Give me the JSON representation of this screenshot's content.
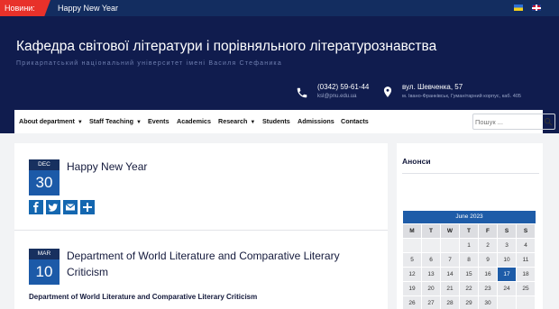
{
  "ticker": {
    "label": "Новини:",
    "headline": "Happy New Year"
  },
  "header": {
    "title": "Кафедра світової літератури і порівняльного літературознавства",
    "subtitle": "Прикарпатський національний університет імені Василя Стефаника",
    "phone": "(0342) 59-61-44",
    "email": "ksl@pnu.edu.ua",
    "street": "вул. Шевченка, 57",
    "address": "м. Івано-Франківськ, Гуманітарний корпус, каб. 405"
  },
  "nav": {
    "items": [
      {
        "label": "About department",
        "dropdown": true
      },
      {
        "label": "Staff Teaching",
        "dropdown": true
      },
      {
        "label": "Events",
        "dropdown": false
      },
      {
        "label": "Academics",
        "dropdown": false
      },
      {
        "label": "Research",
        "dropdown": true
      },
      {
        "label": "Students",
        "dropdown": false
      },
      {
        "label": "Admissions",
        "dropdown": false
      },
      {
        "label": "Contacts",
        "dropdown": false
      }
    ],
    "search_placeholder": "Пошук ..."
  },
  "posts": [
    {
      "month": "DEC",
      "day": "30",
      "title": "Happy New Year"
    },
    {
      "month": "MAR",
      "day": "10",
      "title_line1": "Department of World Literature and Comparative Literary",
      "title_line2": "Criticism",
      "excerpt": "Department of World Literature and Comparative Literary Criticism"
    }
  ],
  "share_icons": [
    "facebook-icon",
    "twitter-icon",
    "email-icon",
    "share-plus-icon"
  ],
  "sidebar": {
    "title": "Анонси",
    "calendar": {
      "caption": "June 2023",
      "weekdays": [
        "M",
        "T",
        "W",
        "T",
        "F",
        "S",
        "S"
      ],
      "rows": [
        [
          "",
          "",
          "",
          "1",
          "2",
          "3",
          "4"
        ],
        [
          "5",
          "6",
          "7",
          "8",
          "9",
          "10",
          "11"
        ],
        [
          "12",
          "13",
          "14",
          "15",
          "16",
          "17",
          "18"
        ],
        [
          "19",
          "20",
          "21",
          "22",
          "23",
          "24",
          "25"
        ],
        [
          "26",
          "27",
          "28",
          "29",
          "30",
          "",
          ""
        ]
      ],
      "today": "17"
    }
  },
  "colors": {
    "header_bg": "#101c4e",
    "ticker_bg": "#132d60",
    "accent": "#e8312a",
    "date_badge": "#1c5aa8"
  }
}
